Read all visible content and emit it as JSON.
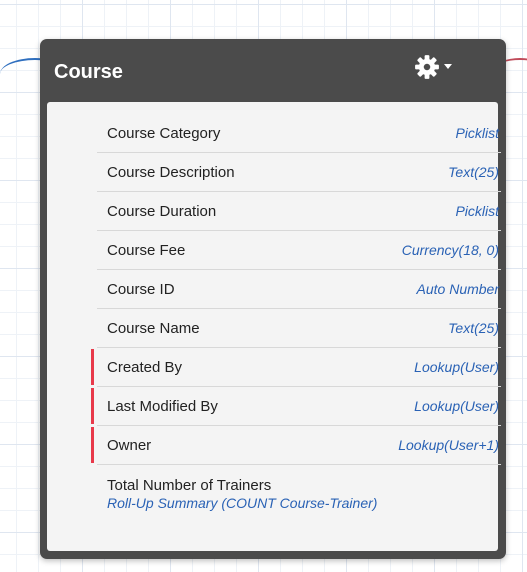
{
  "object": {
    "title": "Course",
    "fields": [
      {
        "name": "Course Category",
        "type": "Picklist",
        "required": false
      },
      {
        "name": "Course Description",
        "type": "Text(25)",
        "required": false
      },
      {
        "name": "Course Duration",
        "type": "Picklist",
        "required": false
      },
      {
        "name": "Course Fee",
        "type": "Currency(18, 0)",
        "required": false
      },
      {
        "name": "Course ID",
        "type": "Auto Number",
        "required": false
      },
      {
        "name": "Course Name",
        "type": "Text(25)",
        "required": false
      },
      {
        "name": "Created By",
        "type": "Lookup(User)",
        "required": true
      },
      {
        "name": "Last Modified By",
        "type": "Lookup(User)",
        "required": true
      },
      {
        "name": "Owner",
        "type": "Lookup(User+1)",
        "required": true
      },
      {
        "name": "Total Number of Trainers",
        "type": "Roll-Up Summary (COUNT Course-Trainer)",
        "required": false
      }
    ]
  },
  "icons": {
    "settings": "gear-icon",
    "menu": "chevron-down-icon"
  },
  "colors": {
    "card_bg": "#4b4b4b",
    "body_bg": "#f4f4f4",
    "type_text": "#2a62b5",
    "required_marker": "#e8394a",
    "relationship_left": "#2f6fbf",
    "relationship_right": "#c04b5a"
  }
}
